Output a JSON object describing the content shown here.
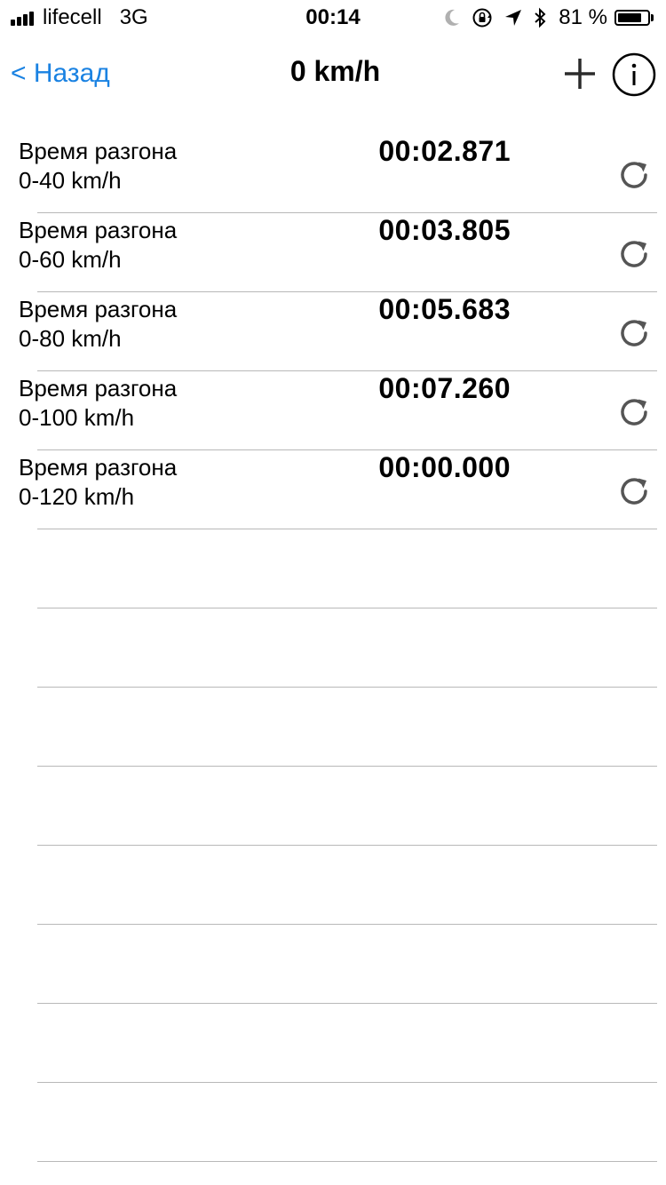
{
  "status_bar": {
    "carrier": "lifecell",
    "network": "3G",
    "time": "00:14",
    "battery_percent": "81 %",
    "battery_level": 0.81
  },
  "nav": {
    "back_label": "< Назад",
    "title": "0 km/h",
    "accent_color": "#1a82e2"
  },
  "rows": [
    {
      "label_line1": "Время разгона",
      "label_line2": "0-40 km/h",
      "time": "00:02.871"
    },
    {
      "label_line1": "Время разгона",
      "label_line2": "0-60 km/h",
      "time": "00:03.805"
    },
    {
      "label_line1": "Время разгона",
      "label_line2": "0-80 km/h",
      "time": "00:05.683"
    },
    {
      "label_line1": "Время разгона",
      "label_line2": "0-100 km/h",
      "time": "00:07.260"
    },
    {
      "label_line1": "Время разгона",
      "label_line2": "0-120 km/h",
      "time": "00:00.000"
    }
  ],
  "empty_row_count": 8,
  "icons": {
    "signal": "signal-bars-icon",
    "moon": "moon-icon",
    "rotation_lock": "rotation-lock-icon",
    "location": "location-arrow-icon",
    "bluetooth": "bluetooth-icon",
    "battery": "battery-icon",
    "add": "plus-icon",
    "info": "info-icon",
    "reset": "refresh-icon"
  }
}
